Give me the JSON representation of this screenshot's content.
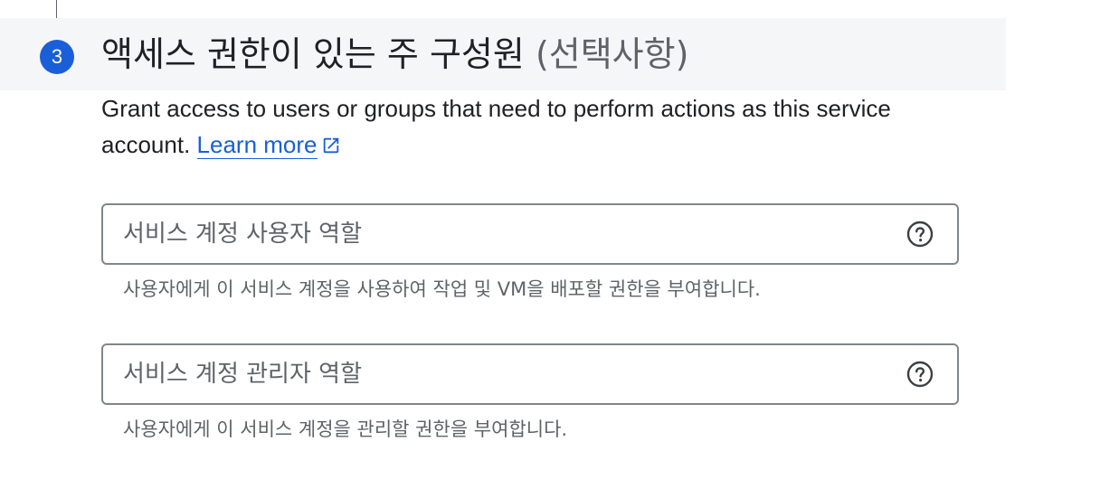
{
  "step": {
    "number": "3",
    "title": "액세스 권한이 있는 주 구성원",
    "optional": "(선택사항)"
  },
  "description": {
    "text": "Grant access to users or groups that need to perform actions as this service account.",
    "link_label": "Learn more",
    "link_icon": "open-in-new-icon"
  },
  "fields": [
    {
      "placeholder": "서비스 계정 사용자 역할",
      "hint": "사용자에게 이 서비스 계정을 사용하여 작업 및 VM을 배포할 권한을 부여합니다.",
      "icon": "help-icon"
    },
    {
      "placeholder": "서비스 계정 관리자 역할",
      "hint": "사용자에게 이 서비스 계정을 관리할 권한을 부여합니다.",
      "icon": "help-icon"
    }
  ],
  "colors": {
    "accent": "#1a5fd8",
    "header_bg": "#f5f6f7",
    "border": "#80868b",
    "secondary_text": "#5f6368"
  }
}
